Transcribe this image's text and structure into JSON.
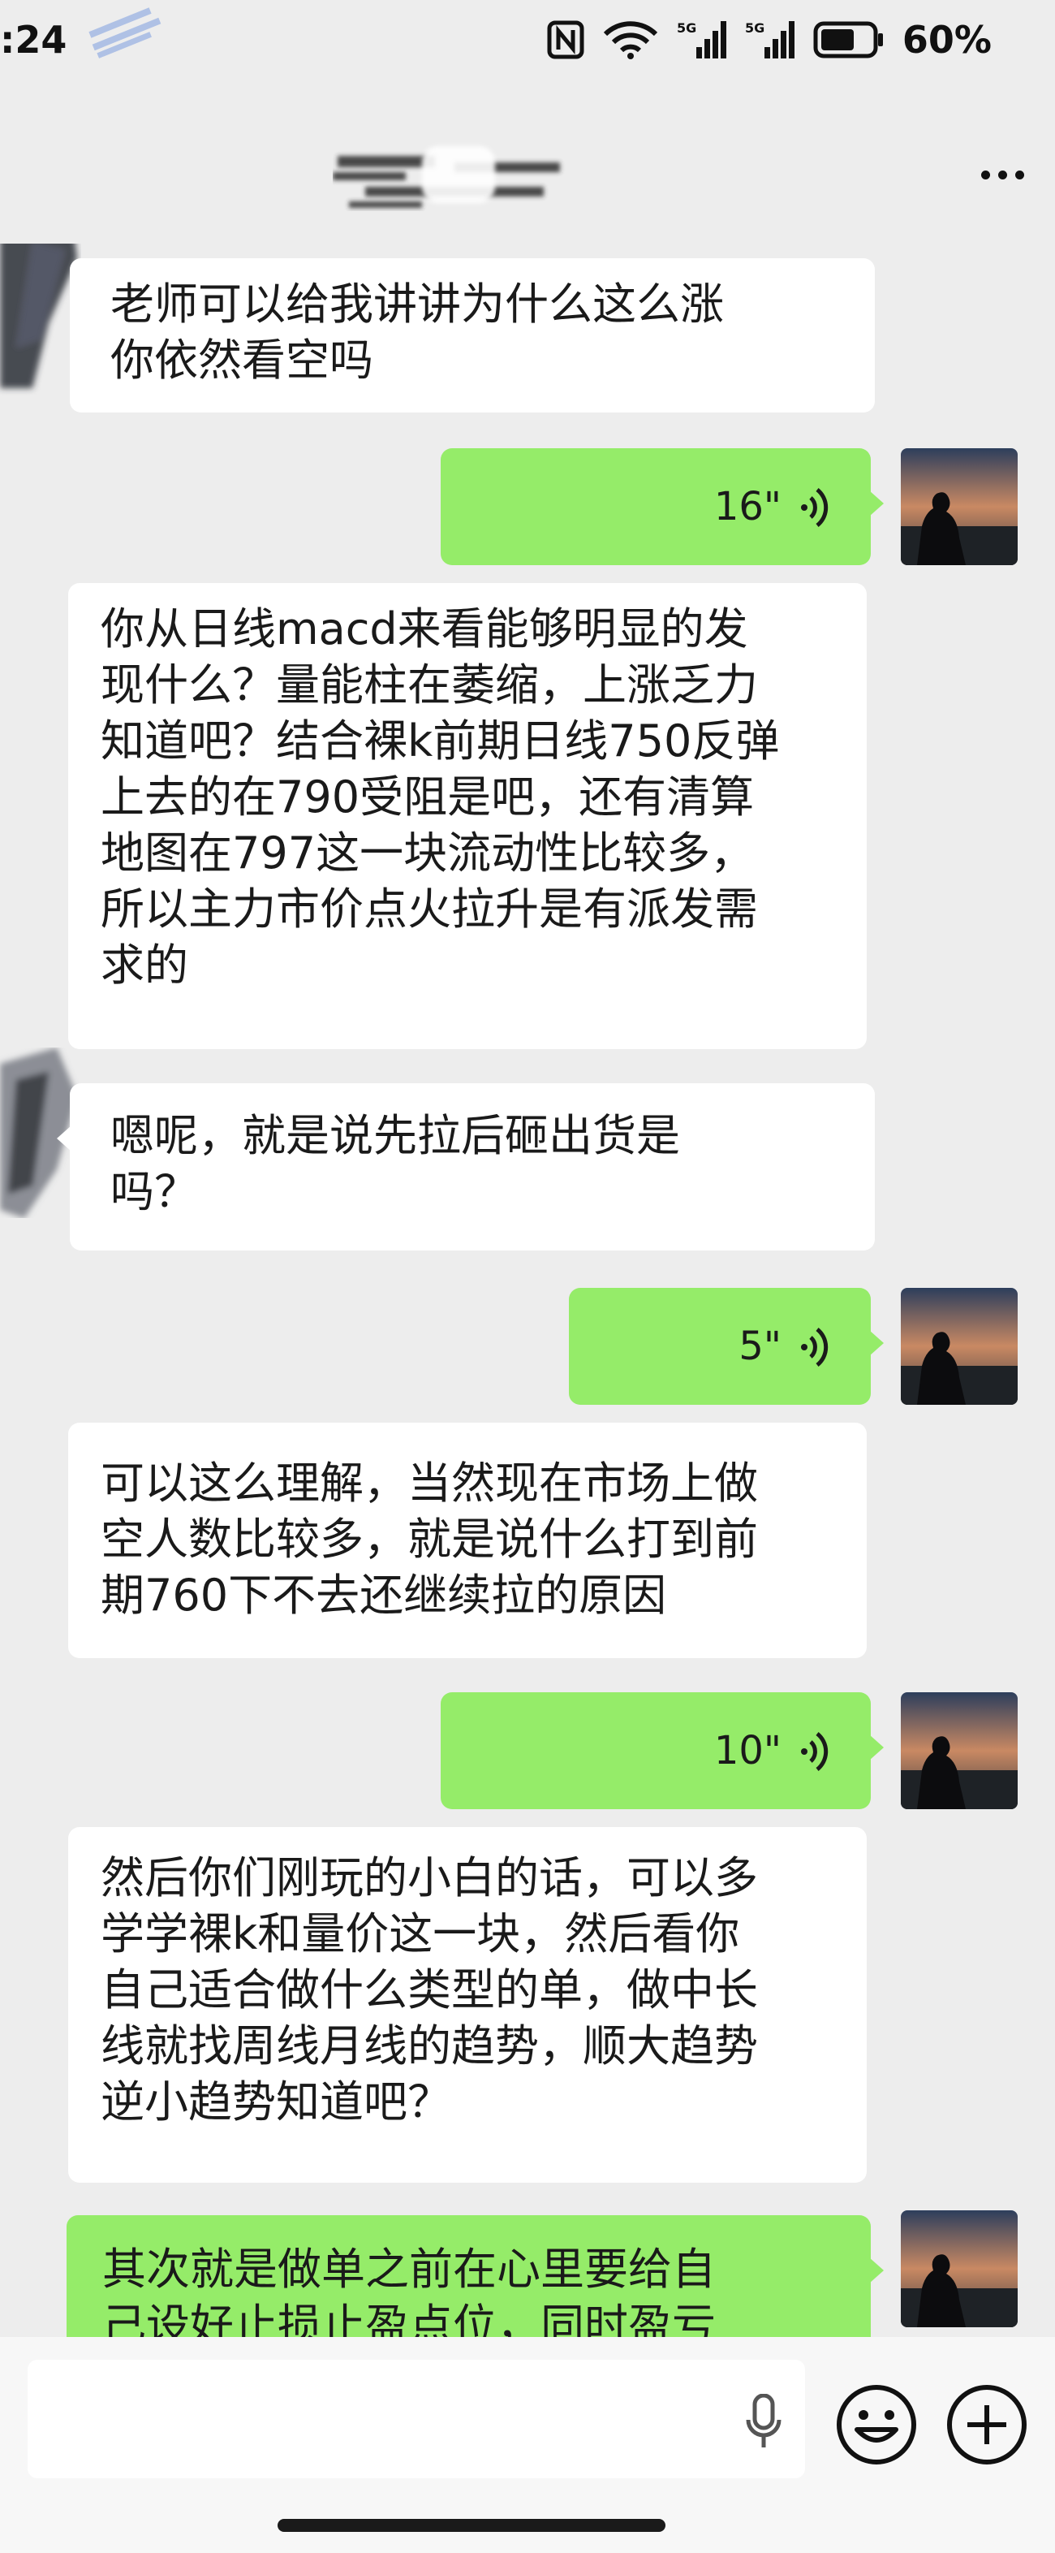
{
  "status_bar": {
    "time": ":24",
    "battery": "60%"
  },
  "conversation": {
    "messages": [
      {
        "side": "left",
        "type": "text",
        "text": "老师可以给我讲讲为什么这么涨\n你依然看空吗"
      },
      {
        "side": "right",
        "type": "voice",
        "duration": "16\""
      },
      {
        "side": "left",
        "type": "text",
        "text": "你从日线macd来看能够明显的发\n现什么？量能柱在萎缩，上涨乏力\n知道吧？结合裸k前期日线750反弹\n上去的在790受阻是吧，还有清算\n地图在797这一块流动性比较多，\n所以主力市价点火拉升是有派发需\n求的"
      },
      {
        "side": "left",
        "type": "text",
        "text": "嗯呢，就是说先拉后砸出货是\n吗？"
      },
      {
        "side": "right",
        "type": "voice",
        "duration": "5\""
      },
      {
        "side": "left",
        "type": "text",
        "text": "可以这么理解，当然现在市场上做\n空人数比较多，就是说什么打到前\n期760下不去还继续拉的原因"
      },
      {
        "side": "right",
        "type": "voice",
        "duration": "10\""
      },
      {
        "side": "left",
        "type": "text",
        "text": "然后你们刚玩的小白的话，可以多\n学学裸k和量价这一块，然后看你\n自己适合做什么类型的单，做中长\n线就找周线月线的趋势，顺大趋势\n逆小趋势知道吧？"
      },
      {
        "side": "right",
        "type": "text",
        "text": "其次就是做单之前在心里要给自\n己设好止损止盈点位，同时盈亏"
      }
    ]
  },
  "input_bar": {
    "placeholder": ""
  },
  "icons": {
    "nfc": "nfc-icon",
    "wifi": "wifi-icon",
    "signal": "signal-5g-icon",
    "battery": "battery-icon",
    "more": "more-icon",
    "voice": "voice-wave-icon",
    "mic": "microphone-icon",
    "emoji": "emoji-icon",
    "plus": "plus-icon"
  },
  "colors": {
    "background": "#ededed",
    "incoming_bubble": "#ffffff",
    "outgoing_bubble": "#95ec69"
  }
}
